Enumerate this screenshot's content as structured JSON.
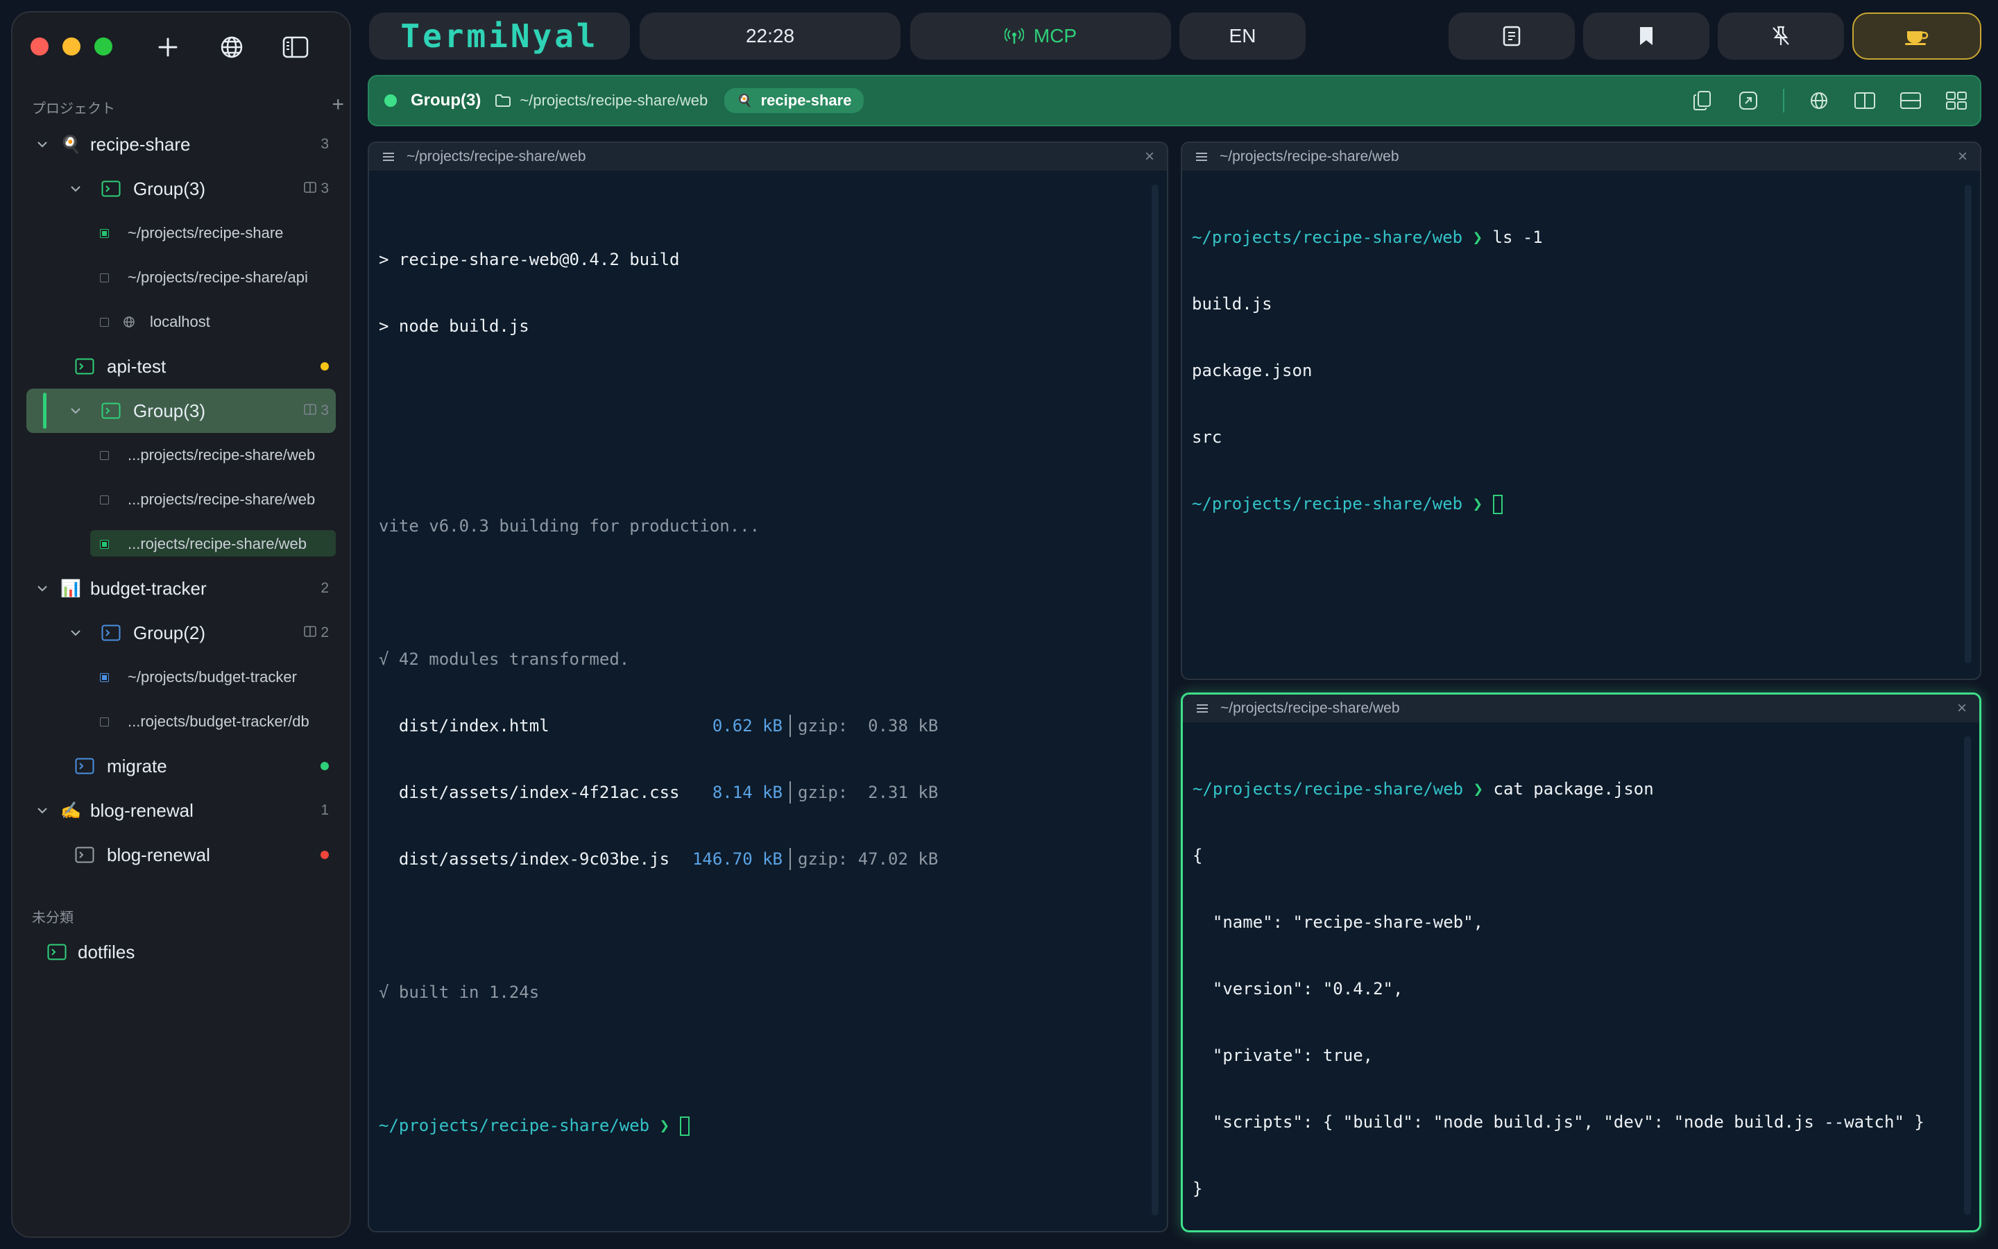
{
  "sidebar": {
    "projects_label": "プロジェクト",
    "add_label": "+",
    "uncategorized_label": "未分類",
    "tree": [
      {
        "level": 0,
        "label": "recipe-share",
        "icon": "emoji",
        "emoji": "🍳",
        "count": "3",
        "expanded": true
      },
      {
        "level": 1,
        "label": "Group(3)",
        "icon": "terminal-icon",
        "count": "3",
        "expanded": true
      },
      {
        "level": 2,
        "label": "~/projects/recipe-share",
        "marker": "green"
      },
      {
        "level": 2,
        "label": "~/projects/recipe-share/api",
        "marker": "empty"
      },
      {
        "level": 2,
        "label": "localhost",
        "marker": "empty",
        "globe": true
      },
      {
        "level": 1,
        "label": "api-test",
        "icon": "terminal-icon",
        "dot": "#f5c518"
      },
      {
        "level": 1,
        "label": "Group(3)",
        "icon": "terminal-icon",
        "count": "3",
        "expanded": true,
        "active": true
      },
      {
        "level": 2,
        "label": "...projects/recipe-share/web",
        "marker": "empty"
      },
      {
        "level": 2,
        "label": "...projects/recipe-share/web",
        "marker": "empty"
      },
      {
        "level": 2,
        "label": "...rojects/recipe-share/web",
        "marker": "green",
        "selected": true
      },
      {
        "level": 0,
        "label": "budget-tracker",
        "icon": "emoji",
        "emoji": "📊",
        "count": "2",
        "expanded": true
      },
      {
        "level": 1,
        "label": "Group(2)",
        "icon": "terminal-icon-blue",
        "count": "2",
        "expanded": true
      },
      {
        "level": 2,
        "label": "~/projects/budget-tracker",
        "marker": "blue"
      },
      {
        "level": 2,
        "label": "...rojects/budget-tracker/db",
        "marker": "empty"
      },
      {
        "level": 1,
        "label": "migrate",
        "icon": "terminal-icon-blue",
        "dot": "#2fd07a"
      },
      {
        "level": 0,
        "label": "blog-renewal",
        "icon": "emoji",
        "emoji": "✍️",
        "count": "1",
        "expanded": true
      },
      {
        "level": 1,
        "label": "blog-renewal",
        "icon": "terminal-icon-gray",
        "dot": "#f0453a"
      }
    ],
    "uncategorized": [
      {
        "label": "dotfiles",
        "icon": "terminal-icon"
      }
    ]
  },
  "topbar": {
    "logo": "TermiNyal",
    "clock": "22:28",
    "mcp": "MCP",
    "lang": "EN"
  },
  "groupbar": {
    "title": "Group(3)",
    "path": "~/projects/recipe-share/web",
    "tag": "recipe-share"
  },
  "panes": {
    "left": {
      "title": "~/projects/recipe-share/web",
      "lines": {
        "l1": "> recipe-share-web@0.4.2 build",
        "l2": "> node build.js",
        "l3": "vite v6.0.3 building for production...",
        "l4": "√ 42 modules transformed.",
        "f1_name": "  dist/index.html",
        "f1_size": "0.62 kB",
        "f1_gzip": "gzip:  0.38 kB",
        "f2_name": "  dist/assets/index-4f21ac.css",
        "f2_size": "8.14 kB",
        "f2_gzip": "gzip:  2.31 kB",
        "f3_name": "  dist/assets/index-9c03be.js",
        "f3_size": "146.70 kB",
        "f3_gzip": "gzip: 47.02 kB",
        "l5": "√ built in 1.24s",
        "prompt": "~/projects/recipe-share/web",
        "prompt_arrow": "❯"
      }
    },
    "top_right": {
      "title": "~/projects/recipe-share/web",
      "lines": {
        "prompt": "~/projects/recipe-share/web",
        "prompt_arrow": "❯",
        "cmd": "ls -1",
        "o1": "build.js",
        "o2": "package.json",
        "o3": "src"
      }
    },
    "bottom_right": {
      "title": "~/projects/recipe-share/web",
      "lines": {
        "prompt": "~/projects/recipe-share/web",
        "prompt_arrow": "❯",
        "cmd": "cat package.json",
        "o1": "{",
        "o2": "  \"name\": \"recipe-share-web\",",
        "o3": "  \"version\": \"0.4.2\",",
        "o4": "  \"private\": true,",
        "o5": "  \"scripts\": { \"build\": \"node build.js\", \"dev\": \"node build.js --watch\" }",
        "o6": "}"
      }
    }
  }
}
